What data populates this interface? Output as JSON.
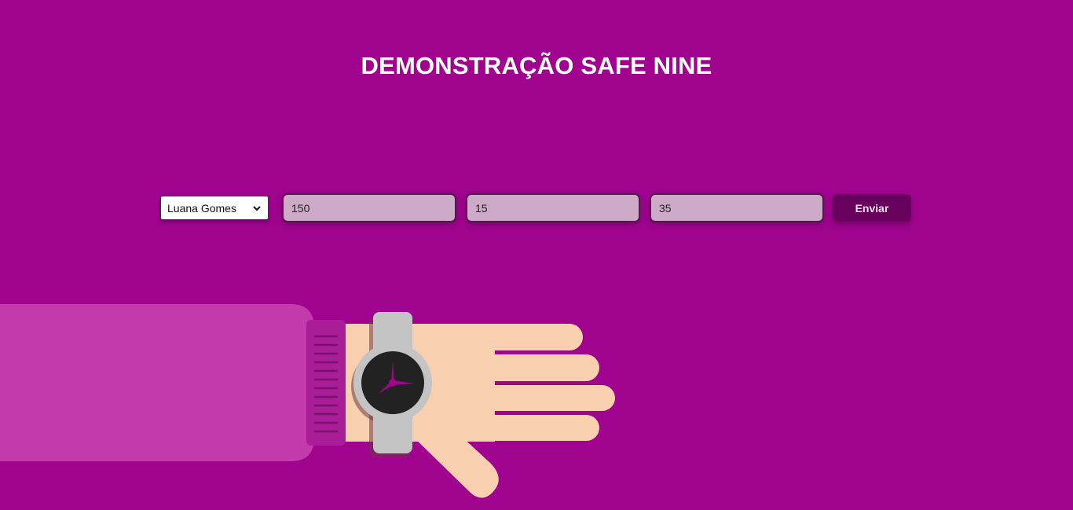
{
  "header": {
    "title": "DEMONSTRAÇÃO SAFE NINE"
  },
  "form": {
    "person_select": {
      "selected": "Luana Gomes"
    },
    "fields": [
      {
        "value": "150"
      },
      {
        "value": "15"
      },
      {
        "value": "35"
      }
    ],
    "submit_label": "Enviar"
  },
  "colors": {
    "background": "#a0048f",
    "input_fill": "#ceaac9",
    "button_fill": "#68005e",
    "sleeve": "#c23aab",
    "cuff": "#a91d96",
    "skin": "#f8d0b0",
    "watch_band": "#c4c4c4",
    "watch_face": "#222222",
    "watch_hands": "#a0048f"
  },
  "illustration": {
    "icons": [
      "hand-illustration",
      "wristwatch-icon"
    ]
  }
}
